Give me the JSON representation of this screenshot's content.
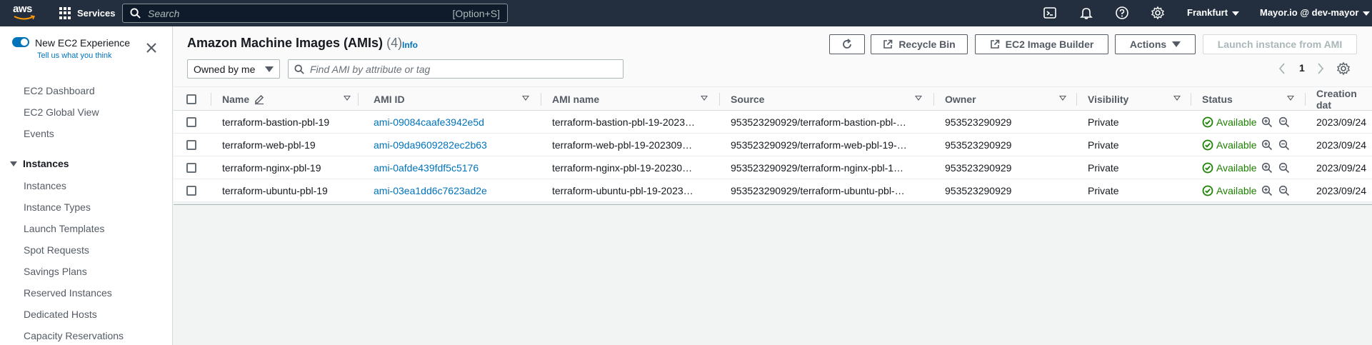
{
  "topnav": {
    "logo": "aws",
    "services_label": "Services",
    "search_placeholder": "Search",
    "search_shortcut": "[Option+S]",
    "region": "Frankfurt",
    "account": "Mayor.io @ dev-mayor"
  },
  "sidebar": {
    "new_experience": "New EC2 Experience",
    "tell_us": "Tell us what you think",
    "links": [
      "EC2 Dashboard",
      "EC2 Global View",
      "Events"
    ],
    "section": "Instances",
    "section_items": [
      "Instances",
      "Instance Types",
      "Launch Templates",
      "Spot Requests",
      "Savings Plans",
      "Reserved Instances",
      "Dedicated Hosts",
      "Capacity Reservations"
    ]
  },
  "header": {
    "title": "Amazon Machine Images (AMIs)",
    "count": "(4)",
    "info": "Info",
    "recycle_bin": "Recycle Bin",
    "image_builder": "EC2 Image Builder",
    "actions": "Actions",
    "launch": "Launch instance from AMI",
    "owned_by": "Owned by me",
    "filter_placeholder": "Find AMI by attribute or tag",
    "page": "1"
  },
  "table": {
    "columns": [
      "Name",
      "AMI ID",
      "AMI name",
      "Source",
      "Owner",
      "Visibility",
      "Status",
      "Creation dat"
    ],
    "rows": [
      {
        "name": "terraform-bastion-pbl-19",
        "ami_id": "ami-09084caafe3942e5d",
        "ami_name": "terraform-bastion-pbl-19-2023…",
        "source": "953523290929/terraform-bastion-pbl-…",
        "owner": "953523290929",
        "visibility": "Private",
        "status": "Available",
        "created": "2023/09/24"
      },
      {
        "name": "terraform-web-pbl-19",
        "ami_id": "ami-09da9609282ec2b63",
        "ami_name": "terraform-web-pbl-19-202309…",
        "source": "953523290929/terraform-web-pbl-19-…",
        "owner": "953523290929",
        "visibility": "Private",
        "status": "Available",
        "created": "2023/09/24"
      },
      {
        "name": "terraform-nginx-pbl-19",
        "ami_id": "ami-0afde439fdf5c5176",
        "ami_name": "terraform-nginx-pbl-19-20230…",
        "source": "953523290929/terraform-nginx-pbl-1…",
        "owner": "953523290929",
        "visibility": "Private",
        "status": "Available",
        "created": "2023/09/24"
      },
      {
        "name": "terraform-ubuntu-pbl-19",
        "ami_id": "ami-03ea1dd6c7623ad2e",
        "ami_name": "terraform-ubuntu-pbl-19-2023…",
        "source": "953523290929/terraform-ubuntu-pbl-…",
        "owner": "953523290929",
        "visibility": "Private",
        "status": "Available",
        "created": "2023/09/24"
      }
    ]
  },
  "colors": {
    "nav_bg": "#232f3e",
    "link": "#0073bb",
    "success": "#1d8102"
  }
}
